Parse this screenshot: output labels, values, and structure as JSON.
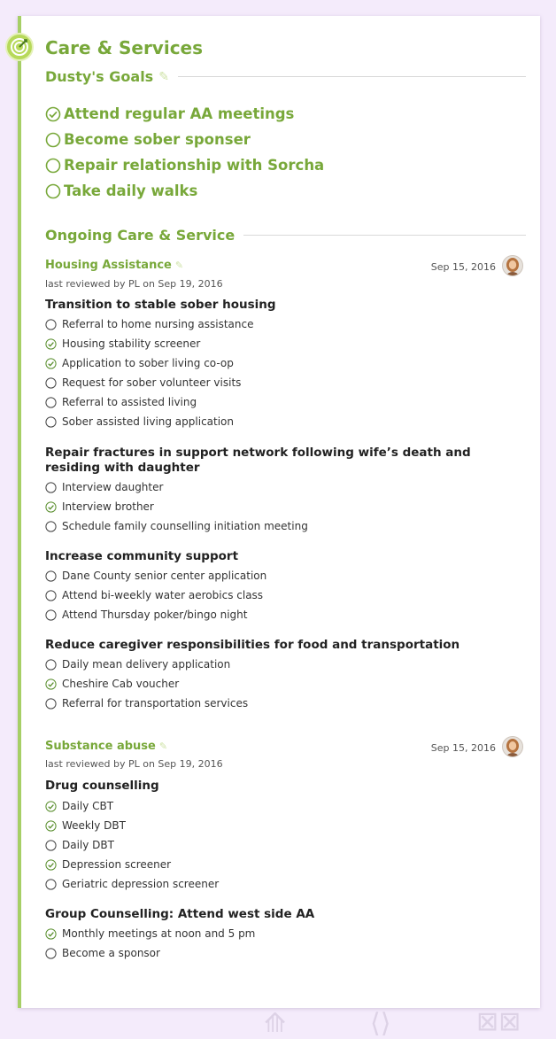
{
  "page_title": "Care & Services",
  "goals": {
    "heading": "Dusty's Goals",
    "items": [
      {
        "label": "Attend regular AA meetings",
        "done": true
      },
      {
        "label": "Become sober sponser",
        "done": false
      },
      {
        "label": "Repair relationship with Sorcha",
        "done": false
      },
      {
        "label": "Take daily walks",
        "done": false
      }
    ]
  },
  "ongoing": {
    "heading": "Ongoing Care & Service",
    "services": [
      {
        "name": "Housing Assistance",
        "reviewed": "last reviewed by PL on Sep 19, 2016",
        "date": "Sep 15, 2016",
        "groups": [
          {
            "title": "Transition to stable sober housing",
            "items": [
              {
                "label": "Referral to home nursing assistance",
                "done": false
              },
              {
                "label": "Housing stability screener",
                "done": true
              },
              {
                "label": "Application to sober living co-op",
                "done": true
              },
              {
                "label": "Request for sober volunteer visits",
                "done": false
              },
              {
                "label": "Referral to assisted living",
                "done": false
              },
              {
                "label": "Sober assisted living application",
                "done": false
              }
            ]
          },
          {
            "title": "Repair fractures in support network following wife’s death and residing with daughter",
            "items": [
              {
                "label": "Interview daughter",
                "done": false
              },
              {
                "label": "Interview brother",
                "done": true
              },
              {
                "label": "Schedule family counselling initiation meeting",
                "done": false
              }
            ]
          },
          {
            "title": "Increase community support",
            "items": [
              {
                "label": "Dane County senior center application",
                "done": false
              },
              {
                "label": "Attend bi-weekly water aerobics class",
                "done": false
              },
              {
                "label": "Attend Thursday poker/bingo night",
                "done": false
              }
            ]
          },
          {
            "title": "Reduce caregiver responsibilities for food and transportation",
            "items": [
              {
                "label": "Daily mean delivery application",
                "done": false
              },
              {
                "label": "Cheshire Cab voucher",
                "done": true
              },
              {
                "label": "Referral for transportation services",
                "done": false
              }
            ]
          }
        ]
      },
      {
        "name": "Substance abuse",
        "reviewed": "last reviewed by PL on Sep 19, 2016",
        "date": "Sep 15, 2016",
        "groups": [
          {
            "title": "Drug counselling",
            "items": [
              {
                "label": "Daily CBT",
                "done": true
              },
              {
                "label": "Weekly DBT",
                "done": true
              },
              {
                "label": "Daily DBT",
                "done": false
              },
              {
                "label": "Depression screener",
                "done": true
              },
              {
                "label": "Geriatric depression screener",
                "done": false
              }
            ]
          },
          {
            "title": "Group Counselling: Attend west side AA",
            "items": [
              {
                "label": "Monthly meetings at noon and 5 pm",
                "done": true
              },
              {
                "label": "Become a sponsor",
                "done": false
              }
            ]
          }
        ]
      }
    ]
  },
  "colors": {
    "accent": "#78a83a",
    "border": "#a6cf66",
    "background": "#f4ebfb"
  }
}
